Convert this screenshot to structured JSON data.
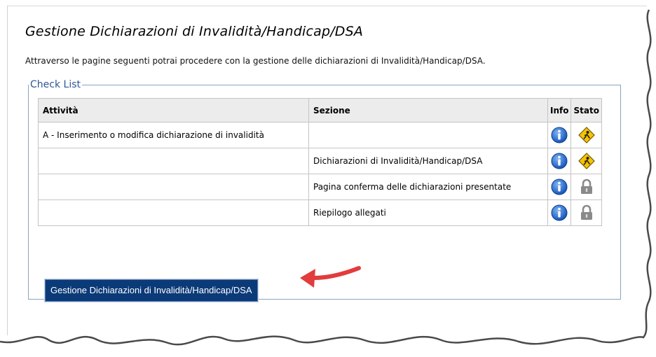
{
  "page": {
    "title": "Gestione Dichiarazioni di Invalidità/Handicap/DSA",
    "intro": "Attraverso le pagine seguenti potrai procedere con la gestione delle dichiarazioni di Invalidità/Handicap/DSA."
  },
  "checklist": {
    "legend": "Check List",
    "headers": {
      "attivita": "Attività",
      "sezione": "Sezione",
      "info": "Info",
      "stato": "Stato"
    },
    "rows": [
      {
        "attivita": "A - Inserimento o modifica dichiarazione di invalidità",
        "sezione": "",
        "info_icon": "info-icon",
        "stato_icon": "in-progress-icon"
      },
      {
        "attivita": "",
        "sezione": "Dichiarazioni di Invalidità/Handicap/DSA",
        "info_icon": "info-icon",
        "stato_icon": "in-progress-icon"
      },
      {
        "attivita": "",
        "sezione": "Pagina conferma delle dichiarazioni presentate",
        "info_icon": "info-icon",
        "stato_icon": "lock-icon"
      },
      {
        "attivita": "",
        "sezione": "Riepilogo allegati",
        "info_icon": "info-icon",
        "stato_icon": "lock-icon"
      }
    ]
  },
  "action_button": {
    "label": "Gestione Dichiarazioni di Invalidità/Handicap/DSA"
  },
  "colors": {
    "button_bg": "#0b3a78",
    "legend_text": "#2c5898",
    "info_icon": "#1f6fd1",
    "warning_icon": "#f5c400",
    "lock_icon": "#8a8a8a",
    "arrow": "#e23c3c"
  }
}
